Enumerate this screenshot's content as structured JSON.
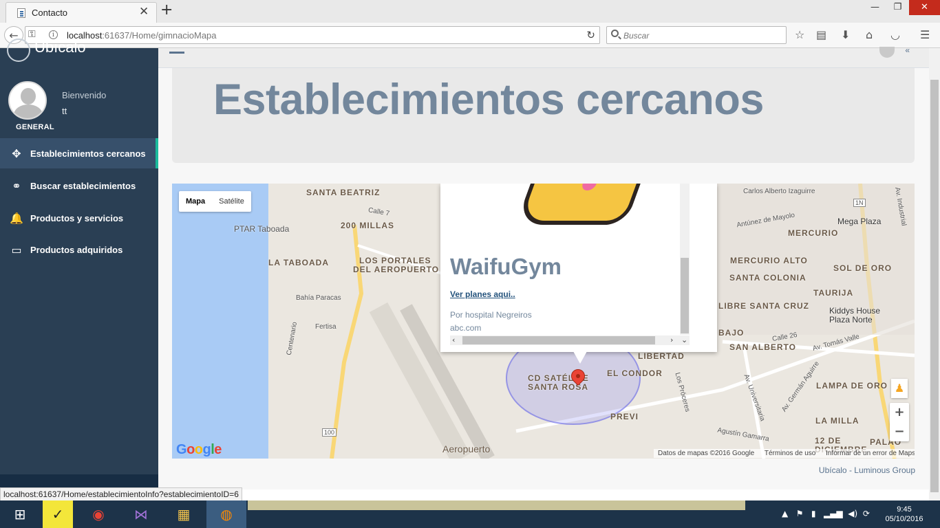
{
  "browser": {
    "tab_title": "Contacto",
    "tab_close": "✕",
    "new_tab": "+",
    "url_host": "localhost",
    "url_rest": ":61637/Home/gimnacioMapa",
    "search_placeholder": "Buscar",
    "window_minimize": "—",
    "window_restore": "❐",
    "window_close": "✕",
    "status_url": "localhost:61637/Home/establecimientoInfo?establecimientoID=6"
  },
  "sidebar": {
    "brand": "Ubícalo",
    "welcome": "Bienvenido",
    "username": "tt",
    "role": "GENERAL",
    "items": [
      {
        "label": "Establecimientos cercanos",
        "icon": "✥",
        "active": true
      },
      {
        "label": "Buscar establecimientos",
        "icon": "⚭"
      },
      {
        "label": "Productos y servicios",
        "icon": "🔔"
      },
      {
        "label": "Productos adquiridos",
        "icon": "▭"
      }
    ]
  },
  "page": {
    "title": "Establecimientos cercanos",
    "footer": "Ubícalo - Luminous Group"
  },
  "map": {
    "type_buttons": [
      "Mapa",
      "Satélite"
    ],
    "labels": [
      "SANTA BEATRIZ",
      "PTAR Taboada",
      "200 MILLAS",
      "LA TABOADA",
      "LOS PORTALES",
      "DEL AEROPUERTO",
      "Bahía Paracas",
      "Fertisa",
      "Centenario",
      "CD SATÉLITE",
      "SANTA ROSA",
      "LIBERTAD",
      "EL CONDOR",
      "PREVI",
      "Aeropuerto",
      "Carlos Alberto Izaguirre",
      "Mega Plaza",
      "MERCURIO",
      "MERCURIO ALTO",
      "SOL DE ORO",
      "SANTA COLONIA",
      "TAURIJA",
      "LIBRE SANTA CRUZ",
      "Kiddys House",
      "Plaza Norte",
      "BAJO",
      "SAN ALBERTO",
      "LAMPA DE ORO",
      "LA MILLA",
      "12 DE",
      "DICIEMBRE",
      "PALAO",
      "Av. Industrial",
      "Antúnez de Mayolo",
      "Av. Tomás Valle",
      "Av. Universitaria",
      "Los Próceres",
      "Agustín Gamarra",
      "Calle 7",
      "Calle 26",
      "Av. Germán Aguirre",
      "100",
      "1N"
    ],
    "infowindow": {
      "title": "WaifuGym",
      "link": "Ver planes aqui..",
      "address": "Por hospital Negreiros",
      "website": "abc.com"
    },
    "zoom_in": "+",
    "zoom_out": "−",
    "attribution": [
      "Datos de mapas ©2016 Google",
      "Términos de uso",
      "Informar de un error de Maps"
    ],
    "logo": {
      "g1": "G",
      "o1": "o",
      "o2": "o",
      "g2": "g",
      "l": "l",
      "e": "e"
    }
  },
  "taskbar": {
    "time": "9:45",
    "date": "05/10/2016"
  }
}
